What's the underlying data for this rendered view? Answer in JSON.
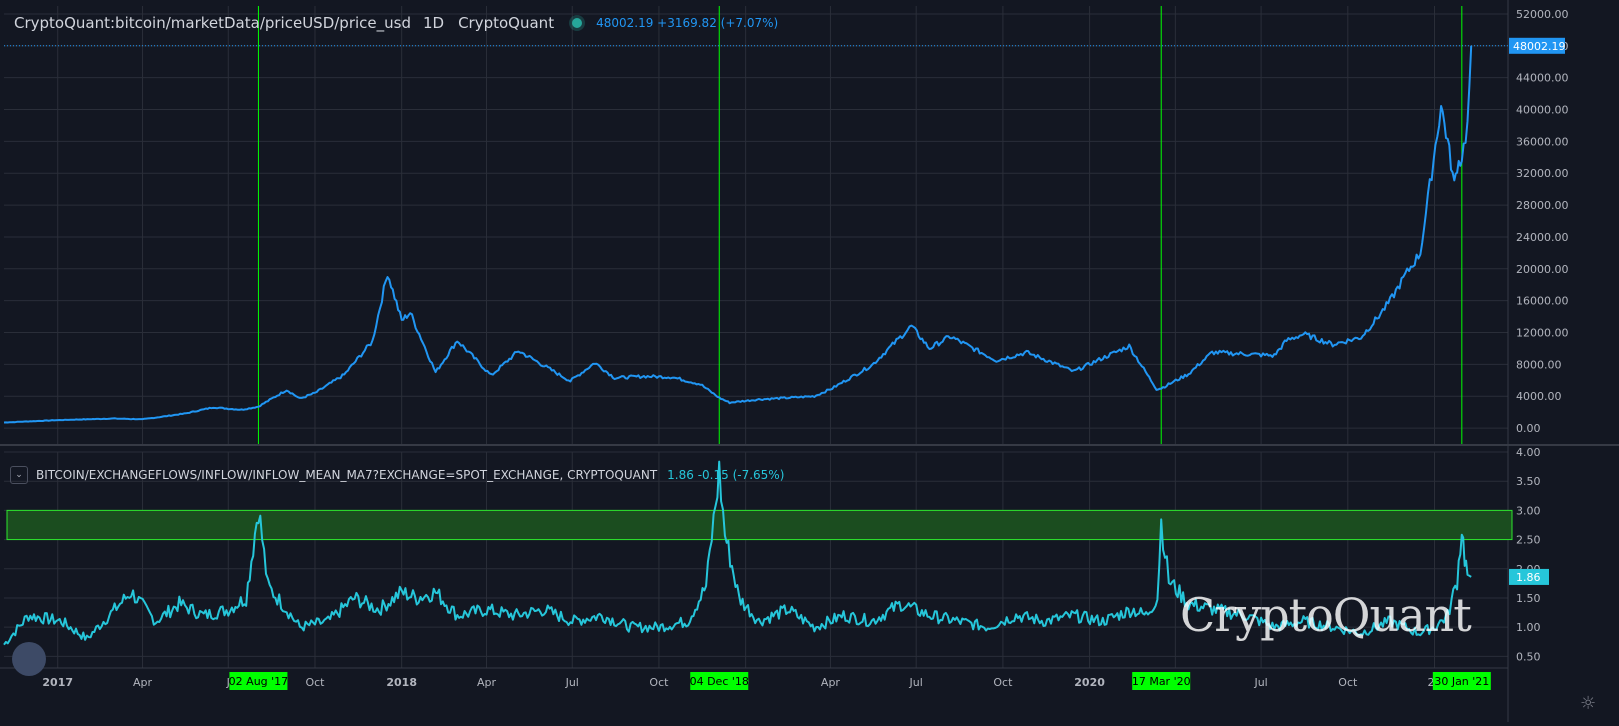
{
  "main_legend": {
    "symbol": "CryptoQuant:bitcoin/marketData/priceUSD/price_usd",
    "interval": "1D",
    "source": "CryptoQuant",
    "values": "48002.19 +3169.82 (+7.07%)"
  },
  "indicator_legend": {
    "title": "BITCOIN/EXCHANGEFLOWS/INFLOW/INFLOW_MEAN_MA7?EXCHANGE=SPOT_EXCHANGE, CRYPTOQUANT",
    "values": "1.86 -0.15 (-7.65%)"
  },
  "watermark": "CryptoQuant",
  "colors": {
    "background": "#131722",
    "price_line": "#2196f3",
    "inflow_line": "#26c6da",
    "event_line": "#00ff00",
    "band_fill": "#1b4d1f",
    "band_border": "#2ee62e",
    "grid": "#2a2e39"
  },
  "chart_data": [
    {
      "type": "line",
      "series": [
        {
          "x": [
            "2016-11-05",
            "2017-01-01",
            "2017-03-01",
            "2017-04-01",
            "2017-05-15",
            "2017-06-15",
            "2017-07-15",
            "2017-08-02",
            "2017-09-01",
            "2017-09-15",
            "2017-10-01",
            "2017-11-01",
            "2017-12-01",
            "2017-12-17",
            "2018-01-01",
            "2018-01-10",
            "2018-02-06",
            "2018-03-01",
            "2018-04-06",
            "2018-05-05",
            "2018-06-29",
            "2018-07-25",
            "2018-08-15",
            "2018-09-15",
            "2018-10-15",
            "2018-11-14",
            "2018-12-04",
            "2018-12-15",
            "2019-01-15",
            "2019-02-15",
            "2019-03-15",
            "2019-04-03",
            "2019-05-15",
            "2019-06-26",
            "2019-07-15",
            "2019-08-06",
            "2019-09-24",
            "2019-10-26",
            "2019-11-15",
            "2019-12-15",
            "2020-01-15",
            "2020-02-12",
            "2020-03-12",
            "2020-03-17",
            "2020-04-15",
            "2020-05-10",
            "2020-06-15",
            "2020-07-15",
            "2020-07-28",
            "2020-08-15",
            "2020-09-15",
            "2020-10-15",
            "2020-11-01",
            "2020-11-15",
            "2020-12-01",
            "2020-12-17",
            "2021-01-08",
            "2021-01-15",
            "2021-01-22",
            "2021-01-25",
            "2021-01-30",
            "2021-02-05",
            "2021-02-09"
          ],
          "y": [
            700,
            1000,
            1200,
            1100,
            1800,
            2600,
            2300,
            2700,
            4800,
            3700,
            4400,
            6700,
            10900,
            19500,
            13500,
            14500,
            7000,
            11000,
            6600,
            9700,
            5900,
            8200,
            6300,
            6500,
            6400,
            5500,
            3800,
            3200,
            3600,
            3800,
            4000,
            5000,
            7900,
            12800,
            10000,
            11500,
            8500,
            9500,
            8600,
            7100,
            8800,
            10300,
            4900,
            5000,
            6800,
            9500,
            9300,
            9100,
            11000,
            11800,
            10500,
            11400,
            13800,
            16000,
            19200,
            22000,
            40500,
            36000,
            30500,
            33000,
            34000,
            38000,
            48002.19
          ]
        }
      ],
      "ylim": [
        -2000,
        53000
      ],
      "yticks": [
        "52000.00",
        "48000.00",
        "44000.00",
        "40000.00",
        "36000.00",
        "32000.00",
        "28000.00",
        "24000.00",
        "20000.00",
        "16000.00",
        "12000.00",
        "8000.00",
        "4000.00",
        "0.00"
      ],
      "last_value": 48002.19,
      "last_value_label": "48002.19"
    },
    {
      "type": "line",
      "series": [
        {
          "x": [
            "2016-11-05",
            "2016-12-01",
            "2017-01-05",
            "2017-02-01",
            "2017-03-20",
            "2017-04-15",
            "2017-05-10",
            "2017-06-05",
            "2017-07-01",
            "2017-07-20",
            "2017-08-02",
            "2017-08-12",
            "2017-09-01",
            "2017-09-15",
            "2017-10-15",
            "2017-11-12",
            "2017-12-08",
            "2018-01-01",
            "2018-01-17",
            "2018-02-06",
            "2018-03-01",
            "2018-04-01",
            "2018-05-01",
            "2018-06-01",
            "2018-07-01",
            "2018-08-01",
            "2018-09-01",
            "2018-10-01",
            "2018-11-01",
            "2018-11-20",
            "2018-12-04",
            "2018-12-10",
            "2018-12-25",
            "2019-01-15",
            "2019-02-15",
            "2019-03-15",
            "2019-04-15",
            "2019-05-15",
            "2019-06-15",
            "2019-07-15",
            "2019-08-15",
            "2019-09-15",
            "2019-10-15",
            "2019-11-15",
            "2019-12-15",
            "2020-01-15",
            "2020-02-15",
            "2020-03-01",
            "2020-03-13",
            "2020-03-17",
            "2020-03-25",
            "2020-04-15",
            "2020-05-12",
            "2020-06-15",
            "2020-07-15",
            "2020-08-15",
            "2020-09-15",
            "2020-10-15",
            "2020-11-15",
            "2020-12-15",
            "2021-01-01",
            "2021-01-15",
            "2021-01-25",
            "2021-01-30",
            "2021-02-02",
            "2021-02-05",
            "2021-02-09"
          ],
          "y": [
            0.7,
            1.2,
            1.1,
            0.8,
            1.6,
            1.1,
            1.4,
            1.2,
            1.3,
            1.5,
            3.05,
            1.7,
            1.3,
            1.0,
            1.1,
            1.5,
            1.3,
            1.6,
            1.5,
            1.6,
            1.2,
            1.3,
            1.2,
            1.3,
            1.1,
            1.2,
            1.0,
            1.0,
            1.1,
            1.7,
            3.65,
            2.6,
            1.5,
            1.1,
            1.3,
            1.0,
            1.2,
            1.1,
            1.4,
            1.2,
            1.1,
            1.0,
            1.2,
            1.1,
            1.2,
            1.1,
            1.3,
            1.2,
            1.5,
            2.8,
            1.8,
            1.4,
            1.3,
            1.2,
            1.0,
            1.1,
            1.0,
            0.9,
            1.1,
            0.9,
            1.0,
            1.2,
            1.8,
            2.7,
            2.2,
            1.9,
            1.86
          ]
        }
      ],
      "ylim": [
        0.3,
        4.0
      ],
      "yticks": [
        "4.00",
        "3.50",
        "3.00",
        "2.50",
        "2.00",
        "1.50",
        "1.00",
        "0.50"
      ],
      "band": [
        2.5,
        3.0
      ],
      "last_value": 1.86,
      "last_value_label": "1.86"
    }
  ],
  "time_axis": {
    "ticks": [
      {
        "date": "2017-01-01",
        "label": "2017"
      },
      {
        "date": "2017-04-01",
        "label": "Apr"
      },
      {
        "date": "2017-07-01",
        "label": "J"
      },
      {
        "date": "2017-10-01",
        "label": "Oct"
      },
      {
        "date": "2018-01-01",
        "label": "2018"
      },
      {
        "date": "2018-04-01",
        "label": "Apr"
      },
      {
        "date": "2018-07-01",
        "label": "Jul"
      },
      {
        "date": "2018-10-01",
        "label": "Oct"
      },
      {
        "date": "2019-01-01",
        "label": "9"
      },
      {
        "date": "2019-04-01",
        "label": "Apr"
      },
      {
        "date": "2019-07-01",
        "label": "Jul"
      },
      {
        "date": "2019-10-01",
        "label": "Oct"
      },
      {
        "date": "2020-01-01",
        "label": "2020"
      },
      {
        "date": "2020-04-01",
        "label": "Apr"
      },
      {
        "date": "2020-07-01",
        "label": "Jul"
      },
      {
        "date": "2020-10-01",
        "label": "Oct"
      },
      {
        "date": "2021-01-01",
        "label": "20"
      }
    ],
    "events": [
      {
        "date": "2017-08-02",
        "label": "02 Aug '17"
      },
      {
        "date": "2018-12-04",
        "label": "04 Dec '18"
      },
      {
        "date": "2020-03-17",
        "label": "17 Mar '20"
      },
      {
        "date": "2021-01-30",
        "label": "30 Jan '21"
      }
    ]
  }
}
